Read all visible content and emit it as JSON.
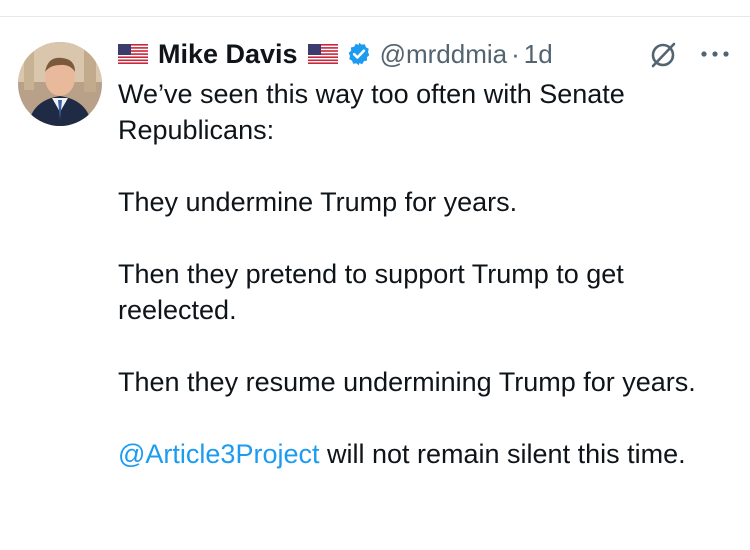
{
  "tweet": {
    "display_name": "Mike Davis",
    "flag_emoji": "🇺🇸",
    "handle": "@mrddmia",
    "separator": "·",
    "time": "1d",
    "paragraphs": [
      "We’ve seen this way too often with Senate Republicans:",
      "They undermine Trump for years.",
      "Then they pretend to support Trump to get reelected.",
      "Then they resume undermining Trump for years."
    ],
    "mention": "@Article3Project",
    "final_text": " will not remain silent this time."
  },
  "colors": {
    "text": "#0f1419",
    "secondary": "#536471",
    "link": "#1d9bf0",
    "verified": "#1d9bf0",
    "divider": "#e6e9ec"
  },
  "icons": {
    "verified": "verified-badge-icon",
    "grok": "grok-icon",
    "more": "more-options-icon",
    "flag": "us-flag-icon"
  }
}
